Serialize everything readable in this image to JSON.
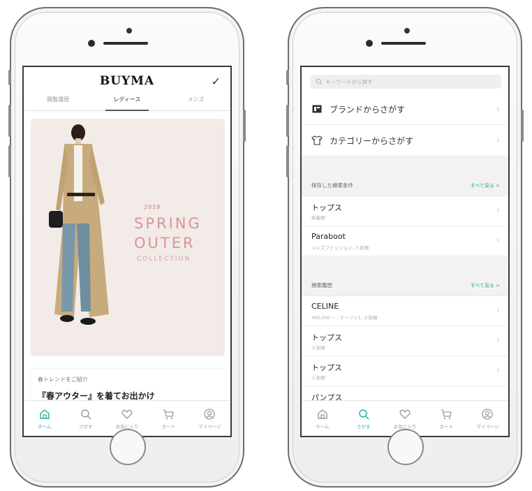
{
  "left_screen": {
    "logo": "BUYMA",
    "tabs": [
      {
        "label": "閲覧履歴"
      },
      {
        "label": "レディース"
      },
      {
        "label": "メンズ"
      }
    ],
    "banner": {
      "year": "2018",
      "line1": "SPRING",
      "line2": "OUTER",
      "line3": "COLLECTION"
    },
    "article": {
      "kicker": "春トレンドをご紹介",
      "title": "『春アウター』を着てお出かけ"
    }
  },
  "right_screen": {
    "search_placeholder": "キーワードから探す",
    "menu": [
      {
        "label": "ブランドからさがす",
        "icon": "brand-icon"
      },
      {
        "label": "カテゴリーからさがす",
        "icon": "shirt-icon"
      }
    ],
    "saved": {
      "title": "保存した検索条件",
      "link": "すべて見る >",
      "items": [
        {
          "title": "トップス",
          "sub": "新着順"
        },
        {
          "title": "Paraboot",
          "sub": "メンズファッション, 人気順"
        }
      ]
    },
    "history": {
      "title": "検索履歴",
      "link": "すべて見る >",
      "items": [
        {
          "title": "CELINE",
          "sub": "¥95,000 ~ , ドーリン1, 人気順"
        },
        {
          "title": "トップス",
          "sub": "人気順"
        },
        {
          "title": "トップス",
          "sub": "人気順"
        },
        {
          "title": "パンプス",
          "sub": ""
        }
      ]
    }
  },
  "nav": {
    "items": [
      {
        "label": "ホーム",
        "icon": "home-icon"
      },
      {
        "label": "さがす",
        "icon": "search-icon"
      },
      {
        "label": "お気に入り",
        "icon": "heart-icon"
      },
      {
        "label": "カート",
        "icon": "cart-icon"
      },
      {
        "label": "マイページ",
        "icon": "user-icon"
      }
    ]
  },
  "colors": {
    "accent": "#24b0a4",
    "banner_text": "#d9949c"
  }
}
